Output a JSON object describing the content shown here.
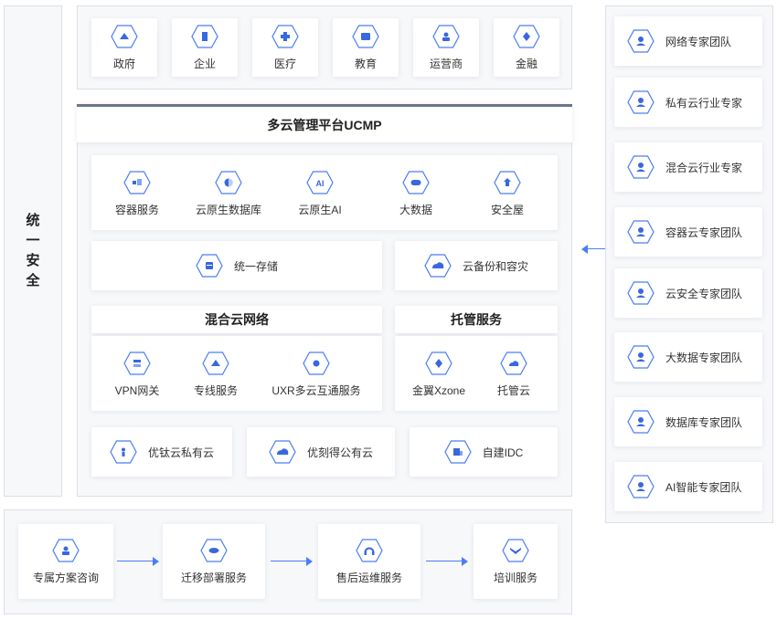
{
  "security": {
    "chars": [
      "统",
      "一",
      "安",
      "全"
    ]
  },
  "industries": [
    {
      "label": "政府",
      "icon": "government-icon"
    },
    {
      "label": "企业",
      "icon": "enterprise-icon"
    },
    {
      "label": "医疗",
      "icon": "medical-icon"
    },
    {
      "label": "教育",
      "icon": "education-icon"
    },
    {
      "label": "运营商",
      "icon": "carrier-icon"
    },
    {
      "label": "金融",
      "icon": "finance-icon"
    }
  ],
  "platform": {
    "title": "多云管理平台UCMP"
  },
  "services_row": [
    {
      "label": "容器服务",
      "icon": "container-icon"
    },
    {
      "label": "云原生数据库",
      "icon": "database-icon"
    },
    {
      "label": "云原生AI",
      "icon": "ai-icon"
    },
    {
      "label": "大数据",
      "icon": "bigdata-icon"
    },
    {
      "label": "安全屋",
      "icon": "security-house-icon"
    }
  ],
  "storage": {
    "label": "统一存储",
    "icon": "storage-icon"
  },
  "backup": {
    "label": "云备份和容灾",
    "icon": "backup-icon"
  },
  "network": {
    "title": "混合云网络",
    "items": [
      {
        "label": "VPN网关",
        "icon": "vpn-icon"
      },
      {
        "label": "专线服务",
        "icon": "dedicated-line-icon"
      },
      {
        "label": "UXR多云互通服务",
        "icon": "interconnect-icon"
      }
    ]
  },
  "hosting": {
    "title": "托管服务",
    "items": [
      {
        "label": "金翼Xzone",
        "icon": "xzone-icon"
      },
      {
        "label": "托管云",
        "icon": "hosted-cloud-icon"
      }
    ]
  },
  "clouds": [
    {
      "label": "优钛云私有云",
      "icon": "private-cloud-icon"
    },
    {
      "label": "优刻得公有云",
      "icon": "public-cloud-icon"
    },
    {
      "label": "自建IDC",
      "icon": "idc-icon"
    }
  ],
  "experts": [
    {
      "label": "网络专家团队"
    },
    {
      "label": "私有云行业专家"
    },
    {
      "label": "混合云行业专家"
    },
    {
      "label": "容器云专家团队"
    },
    {
      "label": "云安全专家团队"
    },
    {
      "label": "大数据专家团队"
    },
    {
      "label": "数据库专家团队"
    },
    {
      "label": "AI智能专家团队"
    }
  ],
  "flow": [
    {
      "label": "专属方案咨询",
      "icon": "consult-icon"
    },
    {
      "label": "迁移部署服务",
      "icon": "migration-icon"
    },
    {
      "label": "售后运维服务",
      "icon": "support-icon"
    },
    {
      "label": "培训服务",
      "icon": "training-icon"
    }
  ],
  "colors": {
    "accent": "#4a7ef5",
    "panel_bg": "#f7f8fa",
    "border": "#dcdfe6"
  }
}
